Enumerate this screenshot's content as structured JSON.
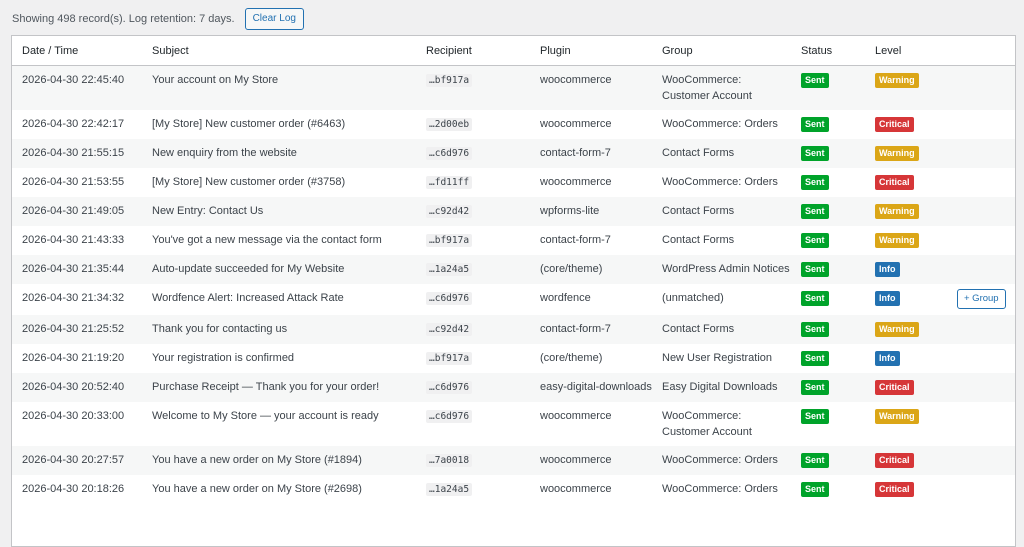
{
  "header": {
    "summary": "Showing 498 record(s). Log retention: 7 days.",
    "clear_log_label": "Clear Log"
  },
  "table": {
    "columns": [
      "Date / Time",
      "Subject",
      "Recipient",
      "Plugin",
      "Group",
      "Status",
      "Level"
    ],
    "rows": [
      {
        "date": "2026-04-30 22:45:40",
        "subject": "Your account on My Store",
        "recipient": "…bf917a",
        "plugin": "woocommerce",
        "group": "WooCommerce: Customer Account",
        "status": "Sent",
        "level": "Warning"
      },
      {
        "date": "2026-04-30 22:42:17",
        "subject": "[My Store] New customer order (#6463)",
        "recipient": "…2d00eb",
        "plugin": "woocommerce",
        "group": "WooCommerce: Orders",
        "status": "Sent",
        "level": "Critical"
      },
      {
        "date": "2026-04-30 21:55:15",
        "subject": "New enquiry from the website",
        "recipient": "…c6d976",
        "plugin": "contact-form-7",
        "group": "Contact Forms",
        "status": "Sent",
        "level": "Warning"
      },
      {
        "date": "2026-04-30 21:53:55",
        "subject": "[My Store] New customer order (#3758)",
        "recipient": "…fd11ff",
        "plugin": "woocommerce",
        "group": "WooCommerce: Orders",
        "status": "Sent",
        "level": "Critical"
      },
      {
        "date": "2026-04-30 21:49:05",
        "subject": "New Entry: Contact Us",
        "recipient": "…c92d42",
        "plugin": "wpforms-lite",
        "group": "Contact Forms",
        "status": "Sent",
        "level": "Warning"
      },
      {
        "date": "2026-04-30 21:43:33",
        "subject": "You've got a new message via the contact form",
        "recipient": "…bf917a",
        "plugin": "contact-form-7",
        "group": "Contact Forms",
        "status": "Sent",
        "level": "Warning"
      },
      {
        "date": "2026-04-30 21:35:44",
        "subject": "Auto-update succeeded for My Website",
        "recipient": "…1a24a5",
        "plugin": "(core/theme)",
        "group": "WordPress Admin Notices",
        "status": "Sent",
        "level": "Info"
      },
      {
        "date": "2026-04-30 21:34:32",
        "subject": "Wordfence Alert: Increased Attack Rate",
        "recipient": "…c6d976",
        "plugin": "wordfence",
        "group": "(unmatched)",
        "status": "Sent",
        "level": "Info",
        "action": "+ Group"
      },
      {
        "date": "2026-04-30 21:25:52",
        "subject": "Thank you for contacting us",
        "recipient": "…c92d42",
        "plugin": "contact-form-7",
        "group": "Contact Forms",
        "status": "Sent",
        "level": "Warning"
      },
      {
        "date": "2026-04-30 21:19:20",
        "subject": "Your registration is confirmed",
        "recipient": "…bf917a",
        "plugin": "(core/theme)",
        "group": "New User Registration",
        "status": "Sent",
        "level": "Info"
      },
      {
        "date": "2026-04-30 20:52:40",
        "subject": "Purchase Receipt — Thank you for your order!",
        "recipient": "…c6d976",
        "plugin": "easy-digital-downloads",
        "group": "Easy Digital Downloads",
        "status": "Sent",
        "level": "Critical"
      },
      {
        "date": "2026-04-30 20:33:00",
        "subject": "Welcome to My Store — your account is ready",
        "recipient": "…c6d976",
        "plugin": "woocommerce",
        "group": "WooCommerce: Customer Account",
        "status": "Sent",
        "level": "Warning"
      },
      {
        "date": "2026-04-30 20:27:57",
        "subject": "You have a new order on My Store (#1894)",
        "recipient": "…7a0018",
        "plugin": "woocommerce",
        "group": "WooCommerce: Orders",
        "status": "Sent",
        "level": "Critical"
      },
      {
        "date": "2026-04-30 20:18:26",
        "subject": "You have a new order on My Store (#2698)",
        "recipient": "…1a24a5",
        "plugin": "woocommerce",
        "group": "WooCommerce: Orders",
        "status": "Sent",
        "level": "Critical"
      }
    ]
  },
  "colors": {
    "sent": "#00a32a",
    "warning": "#dba617",
    "critical": "#d63638",
    "info": "#2271b1"
  }
}
